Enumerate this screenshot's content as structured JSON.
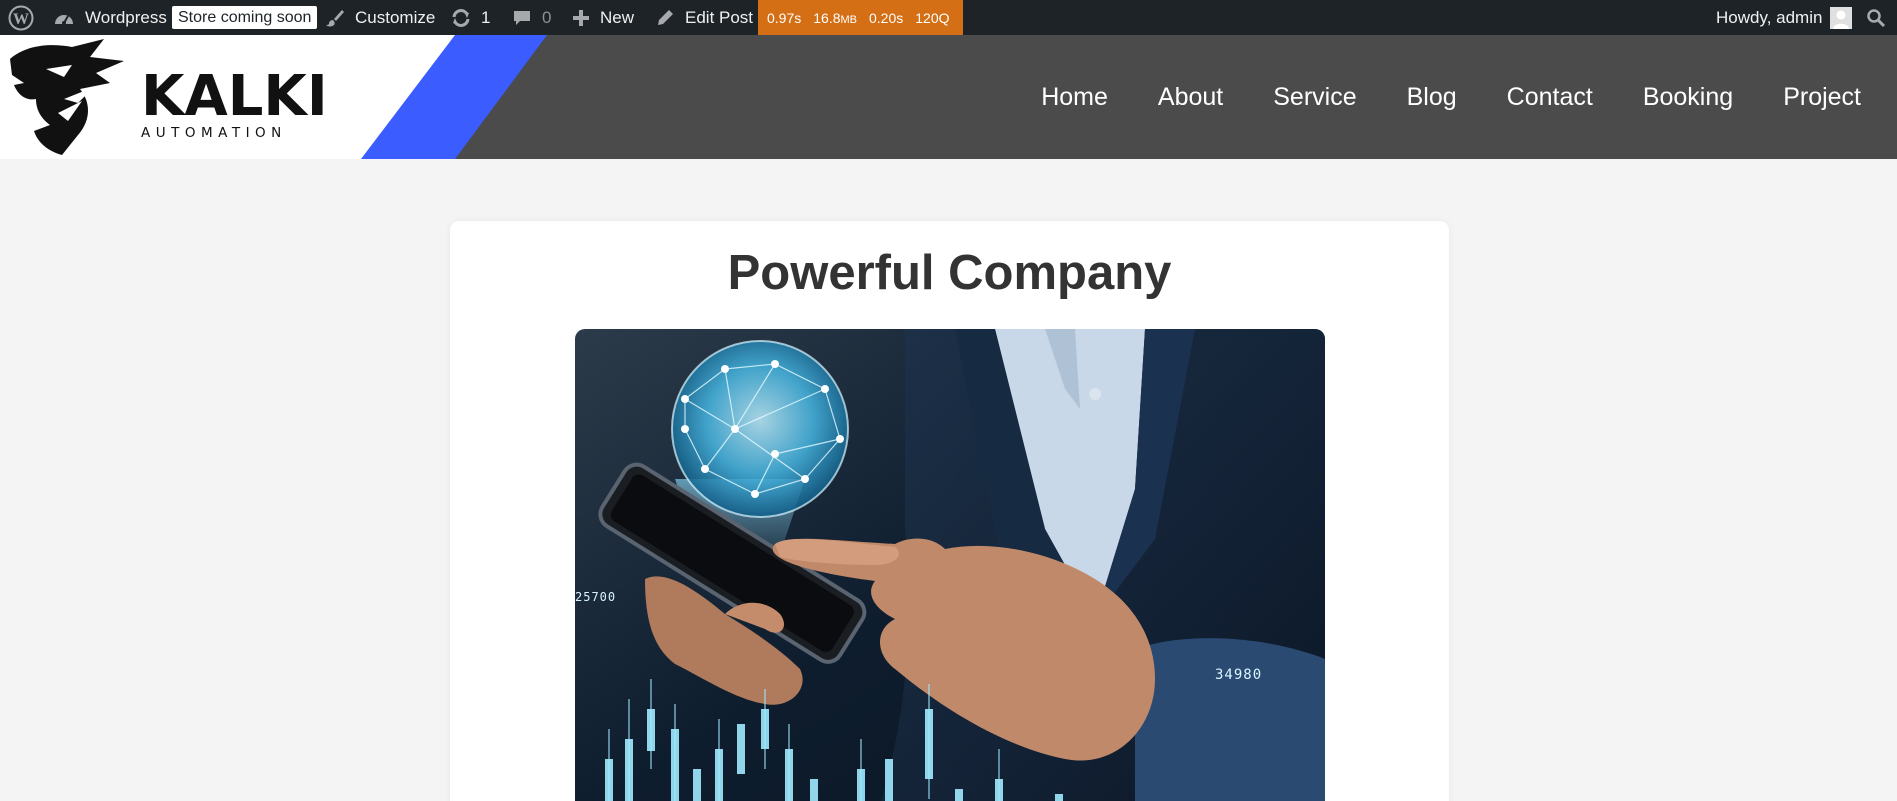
{
  "admin_bar": {
    "site_name": "Wordpress",
    "store_badge": "Store coming soon",
    "customize": "Customize",
    "updates_count": "1",
    "comments_count": "0",
    "new_label": "New",
    "edit_post": "Edit Post",
    "query_monitor": {
      "time": "0.97s",
      "memory_value": "16.8",
      "memory_unit": "MB",
      "db_time": "0.20s",
      "queries": "120Q"
    },
    "howdy": "Howdy, admin",
    "colors": {
      "bar": "#1d2327",
      "query_monitor": "#d46f15"
    }
  },
  "header": {
    "logo": {
      "name": "KALKI",
      "tagline": "AUTOMATION"
    },
    "nav": [
      "Home",
      "About",
      "Service",
      "Blog",
      "Contact",
      "Booking",
      "Project"
    ],
    "colors": {
      "background": "#4b4b4b",
      "accent": "#3b5cff"
    }
  },
  "post": {
    "title": "Powerful Company",
    "image": {
      "readout_left": "25700",
      "readout_right": "34980"
    }
  }
}
